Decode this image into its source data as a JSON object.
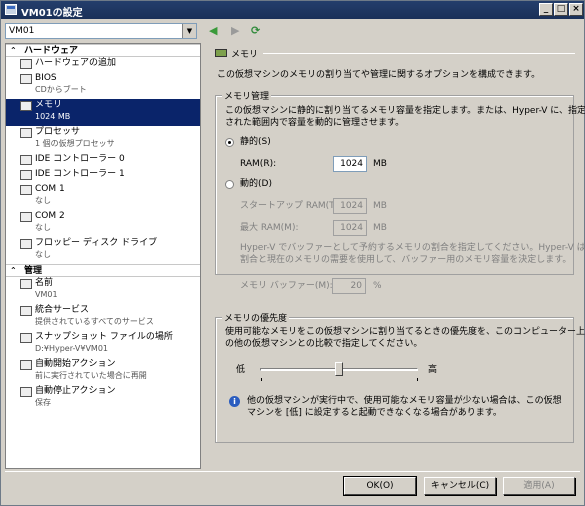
{
  "window": {
    "title": "VM01の設定"
  },
  "toolbar": {
    "vm_selected": "VM01",
    "back_icon": "arrow-left-icon",
    "forward_icon": "arrow-right-icon",
    "refresh_icon": "refresh-icon"
  },
  "sidebar": {
    "hardware_header": "ハードウェア",
    "hardware_items": [
      {
        "label": "ハードウェアの追加",
        "sub": ""
      },
      {
        "label": "BIOS",
        "sub": "CDからブート"
      },
      {
        "label": "メモリ",
        "sub": "1024 MB"
      },
      {
        "label": "プロセッサ",
        "sub": "1 個の仮想プロセッサ"
      },
      {
        "label": "IDE コントローラー 0",
        "sub": ""
      },
      {
        "label": "IDE コントローラー 1",
        "sub": ""
      },
      {
        "label": "COM 1",
        "sub": "なし"
      },
      {
        "label": "COM 2",
        "sub": "なし"
      },
      {
        "label": "フロッピー ディスク ドライブ",
        "sub": "なし"
      }
    ],
    "management_header": "管理",
    "management_items": [
      {
        "label": "名前",
        "sub": "VM01"
      },
      {
        "label": "統合サービス",
        "sub": "提供されているすべてのサービス"
      },
      {
        "label": "スナップショット ファイルの場所",
        "sub": "D:¥Hyper-V¥VM01"
      },
      {
        "label": "自動開始アクション",
        "sub": "前に実行されていた場合に再開"
      },
      {
        "label": "自動停止アクション",
        "sub": "保存"
      }
    ]
  },
  "pane": {
    "header": "メモリ",
    "intro": "この仮想マシンのメモリの割り当てや管理に関するオプションを構成できます。",
    "mgmt_group": "メモリ管理",
    "mgmt_desc_1": "この仮想マシンに静的に割り当てるメモリ容量を指定します。または、Hyper-V に、指定",
    "mgmt_desc_2": "された範囲内で容量を動的に管理させます。",
    "static_label": "静的(S)",
    "ram_label": "RAM(R):",
    "ram_value": "1024",
    "unit_mb": "MB",
    "dynamic_label": "動的(D)",
    "startup_ram_label": "スタートアップ RAM(T):",
    "startup_ram_value": "1024",
    "max_ram_label": "最大 RAM(M):",
    "max_ram_value": "1024",
    "buffer_desc_1": "Hyper-V でバッファーとして予約するメモリの割合を指定してください。Hyper-V はこの",
    "buffer_desc_2": "割合と現在のメモリの需要を使用して、バッファー用のメモリ容量を決定します。",
    "buffer_label": "メモリ バッファー(M):",
    "buffer_value": "20",
    "unit_pct": "%",
    "priority_group": "メモリの優先度",
    "priority_desc_1": "使用可能なメモリをこの仮想マシンに割り当てるときの優先度を、このコンピューター上",
    "priority_desc_2": "の他の仮想マシンとの比較で指定してください。",
    "low": "低",
    "high": "高",
    "priority_level": 0.5,
    "warning_1": "他の仮想マシンが実行中で、使用可能なメモリ容量が少ない場合は、この仮想",
    "warning_2": "マシンを [低] に設定すると起動できなくなる場合があります。"
  },
  "buttons": {
    "ok": "OK(O)",
    "cancel": "キャンセル(C)",
    "apply": "適用(A)"
  }
}
